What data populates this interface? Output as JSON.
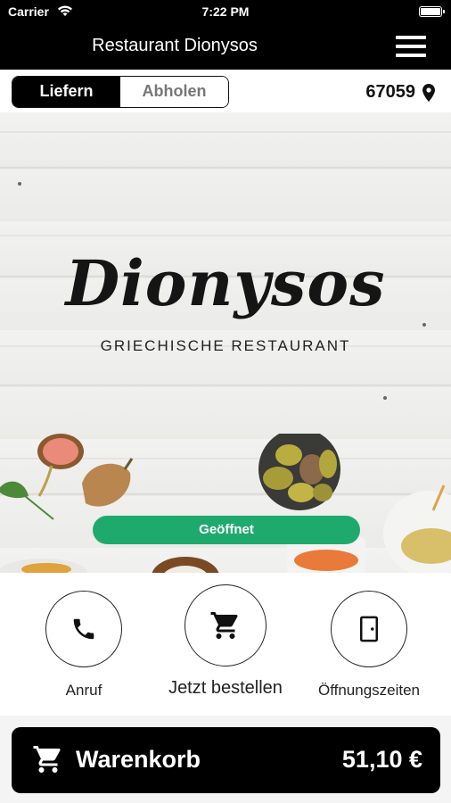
{
  "status_bar": {
    "carrier": "Carrier",
    "time": "7:22 PM"
  },
  "header": {
    "title": "Restaurant Dionysos",
    "menu_icon": "hamburger-icon"
  },
  "order_mode": {
    "options": [
      "Liefern",
      "Abholen"
    ],
    "selected": "Liefern"
  },
  "location": {
    "postal_code": "67059",
    "icon": "location-pin-icon"
  },
  "hero": {
    "logo_title": "Dionysos",
    "logo_subtitle": "GRIECHISCHE RESTAURANT",
    "open_status": "Geöffnet",
    "status_color": "#1faa6d"
  },
  "actions": [
    {
      "label": "Anruf",
      "icon": "phone-icon"
    },
    {
      "label": "Jetzt bestellen",
      "icon": "cart-icon"
    },
    {
      "label": "Öffnungszeiten",
      "icon": "door-icon"
    }
  ],
  "cart": {
    "label": "Warenkorb",
    "total": "51,10 €",
    "icon": "cart-icon"
  }
}
